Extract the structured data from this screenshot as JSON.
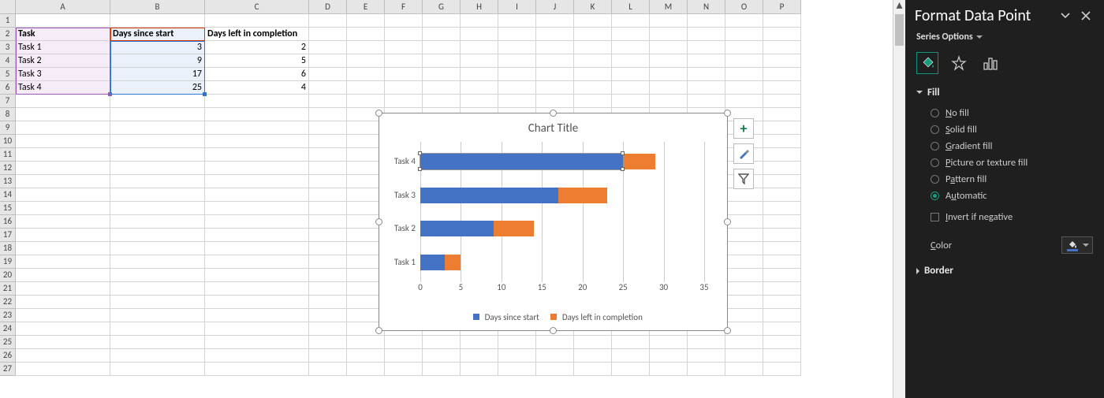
{
  "columns": [
    "A",
    "B",
    "C",
    "D",
    "E",
    "F",
    "G",
    "H",
    "I",
    "J",
    "K",
    "L",
    "M",
    "N",
    "O",
    "P"
  ],
  "colWidths": {
    "A": 120,
    "B": 120,
    "C": 132,
    "D": 48,
    "E": 48,
    "F": 48,
    "G": 48,
    "H": 48,
    "I": 48,
    "J": 48,
    "K": 48,
    "L": 48,
    "M": 48,
    "N": 48,
    "O": 48,
    "P": 48
  },
  "rows": 27,
  "cells": {
    "A2": "Task",
    "B2": "Days since start",
    "C2": "Days left in completion",
    "A3": "Task 1",
    "B3": "3",
    "C3": "2",
    "A4": "Task 2",
    "B4": "9",
    "C4": "5",
    "A5": "Task 3",
    "B5": "17",
    "C5": "6",
    "A6": "Task 4",
    "B6": "25",
    "C6": "4"
  },
  "chart": {
    "title": "Chart Title",
    "legend": {
      "series1": "Days since start",
      "series2": "Days left in completion"
    },
    "sideButtons": {
      "plus": "+",
      "brush": "brush",
      "filter": "filter"
    }
  },
  "chart_data": {
    "type": "bar",
    "orientation": "horizontal",
    "stacked": true,
    "categories": [
      "Task 4",
      "Task 3",
      "Task 2",
      "Task 1"
    ],
    "x_ticks": [
      0,
      5,
      10,
      15,
      20,
      25,
      30,
      35
    ],
    "xlim": [
      0,
      35
    ],
    "series": [
      {
        "name": "Days since start",
        "values": [
          25,
          17,
          9,
          3
        ],
        "color": "#4472C4"
      },
      {
        "name": "Days left in completion",
        "values": [
          4,
          6,
          5,
          2
        ],
        "color": "#ED7D31"
      }
    ],
    "selected_point": {
      "series": "Days since start",
      "category": "Task 4"
    },
    "title": "Chart Title"
  },
  "pane": {
    "title": "Format Data Point",
    "series_options": "Series Options",
    "fill_section": "Fill",
    "fill_options": [
      {
        "key": "nofill",
        "label_pre": "",
        "label_u": "N",
        "label_post": "o fill"
      },
      {
        "key": "solid",
        "label_pre": "",
        "label_u": "S",
        "label_post": "olid fill"
      },
      {
        "key": "gradient",
        "label_pre": "",
        "label_u": "G",
        "label_post": "radient fill"
      },
      {
        "key": "picture",
        "label_pre": "",
        "label_u": "P",
        "label_post": "icture or texture fill"
      },
      {
        "key": "pattern",
        "label_pre": "P",
        "label_u": "a",
        "label_post": "ttern fill"
      },
      {
        "key": "auto",
        "label_pre": "A",
        "label_u": "u",
        "label_post": "tomatic"
      }
    ],
    "fill_selected": "auto",
    "invert_label_pre": "",
    "invert_label_u": "I",
    "invert_label_post": "nvert if negative",
    "color_label_u": "C",
    "color_label_post": "olor",
    "border_section": "Border"
  }
}
